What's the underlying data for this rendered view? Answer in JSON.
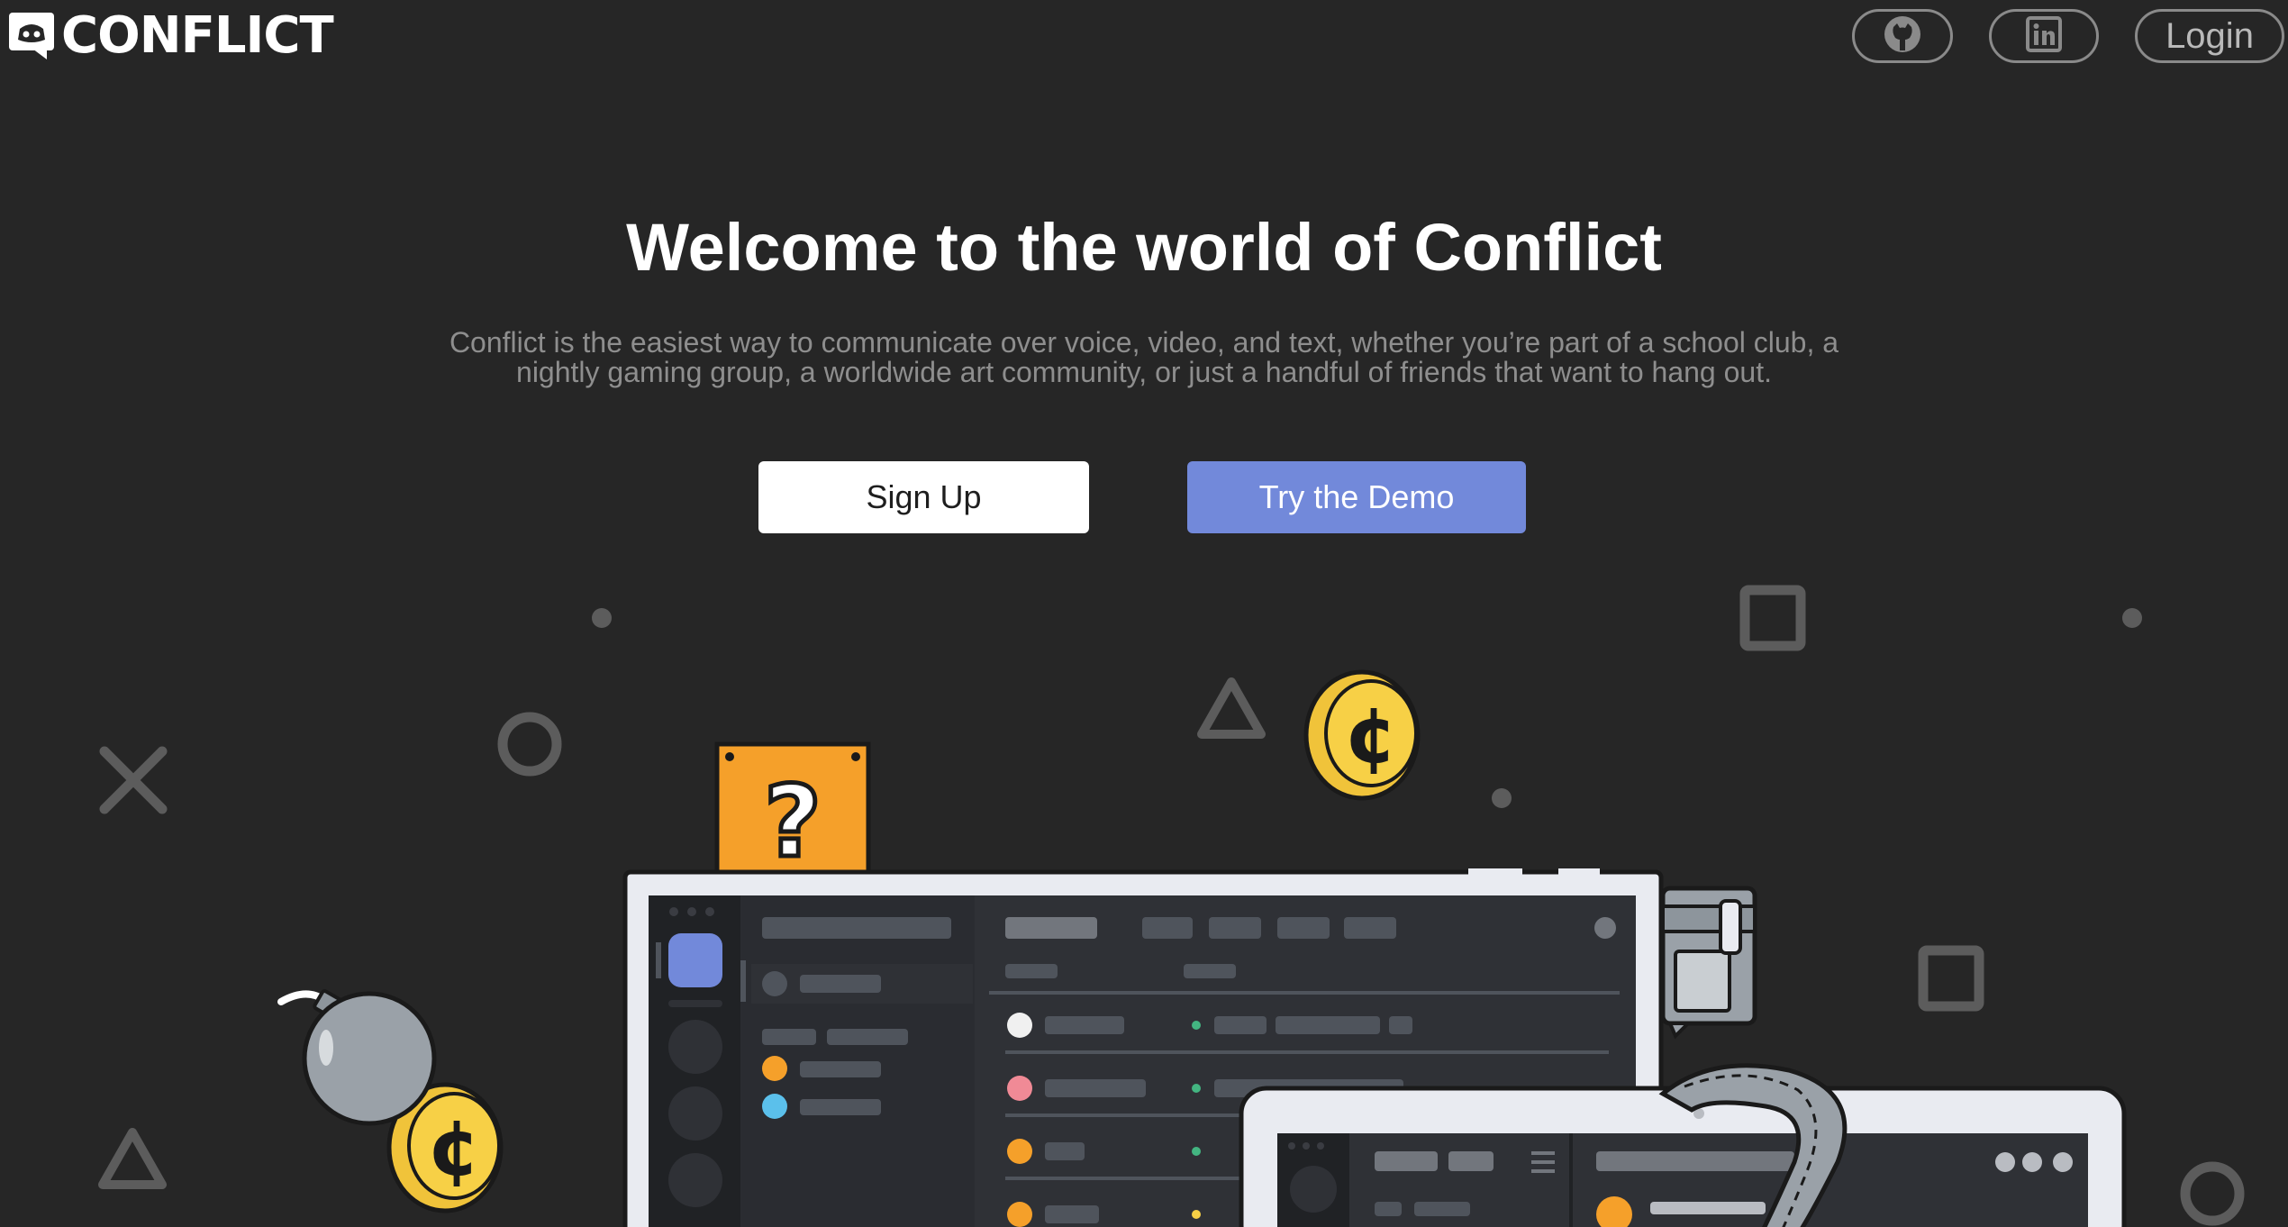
{
  "nav": {
    "brand": "CONFLICT",
    "github_icon": "github-icon",
    "linkedin_icon": "linkedin-icon",
    "login_label": "Login"
  },
  "hero": {
    "title": "Welcome to the world of Conflict",
    "description": "Conflict is the easiest way to communicate over voice, video, and text, whether you’re part of a school club, a nightly gaming group, a worldwide art community, or just a handful of friends that want to hang out.",
    "signup_label": "Sign Up",
    "demo_label": "Try the Demo"
  },
  "illustration": {
    "question_mark": "?",
    "coin_symbol": "¢"
  },
  "colors": {
    "background": "#262626",
    "accent": "#7289da",
    "shape_gray": "#5c5c5c",
    "coin_yellow": "#f7d046",
    "box_orange": "#f5a02a"
  }
}
